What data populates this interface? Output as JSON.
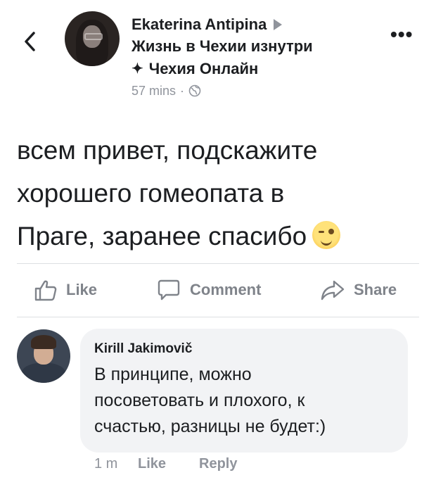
{
  "post": {
    "author": "Ekaterina Antipina",
    "group": "Жизнь в Чехии изнутри",
    "subgroup": "Чехия Онлайн",
    "subgroup_icon": "sparkle-icon",
    "time": "57 mins",
    "separator": "·",
    "privacy_icon": "globe-icon",
    "text_line1": "всем привет, подскажите",
    "text_line2": "хорошего гомеопата в",
    "text_line3": "Праге, заранее спасибо",
    "emoji": "winking-face-emoji"
  },
  "actions": {
    "like": "Like",
    "comment": "Comment",
    "share": "Share"
  },
  "comment": {
    "author": "Kirill Jakimovič",
    "text_line1": "В принципе, можно",
    "text_line2": "посоветовать и плохого, к",
    "text_line3": "счастью, разницы не будет:)",
    "time": "1 m",
    "like": "Like",
    "reply": "Reply"
  },
  "colors": {
    "text": "#1c1e21",
    "muted": "#90949c",
    "bubble": "#f2f3f5",
    "divider": "#dddfe2"
  }
}
